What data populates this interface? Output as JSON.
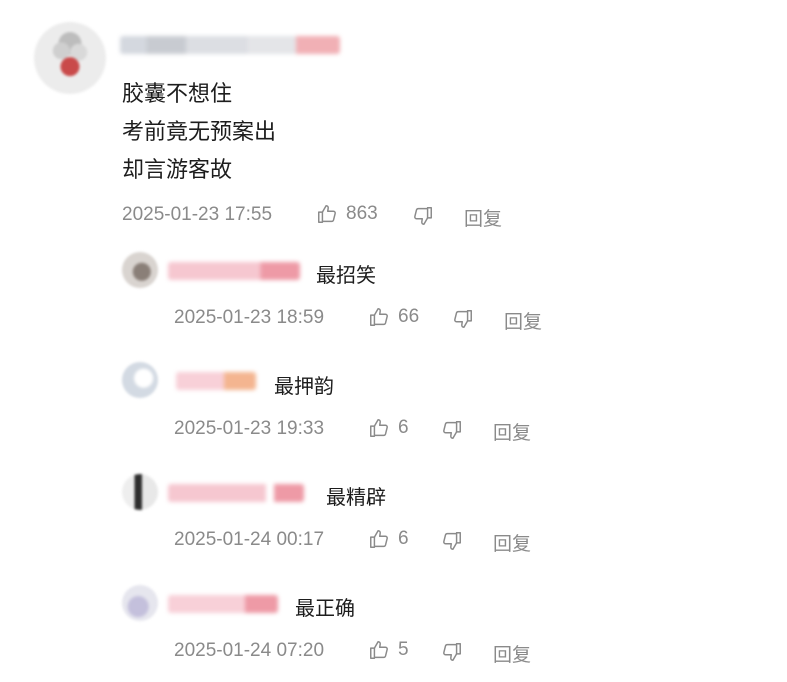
{
  "main_comment": {
    "lines": [
      "胶囊不想住",
      "考前竟无预案出",
      "却言游客故"
    ],
    "timestamp": "2025-01-23 17:55",
    "likes": "863",
    "reply_label": "回复"
  },
  "replies": [
    {
      "text": "最招笑",
      "timestamp": "2025-01-23 18:59",
      "likes": "66",
      "reply_label": "回复"
    },
    {
      "text": "最押韵",
      "timestamp": "2025-01-23 19:33",
      "likes": "6",
      "reply_label": "回复"
    },
    {
      "text": "最精辟",
      "timestamp": "2025-01-24 00:17",
      "likes": "6",
      "reply_label": "回复"
    },
    {
      "text": "最正确",
      "timestamp": "2025-01-24 07:20",
      "likes": "5",
      "reply_label": "回复"
    }
  ],
  "icons": {
    "like": "thumbs-up-icon",
    "dislike": "thumbs-down-icon"
  },
  "colors": {
    "meta_gray": "#8a8a8a",
    "text": "#1d1d1d",
    "blur_pink": "#f1b0b5"
  }
}
